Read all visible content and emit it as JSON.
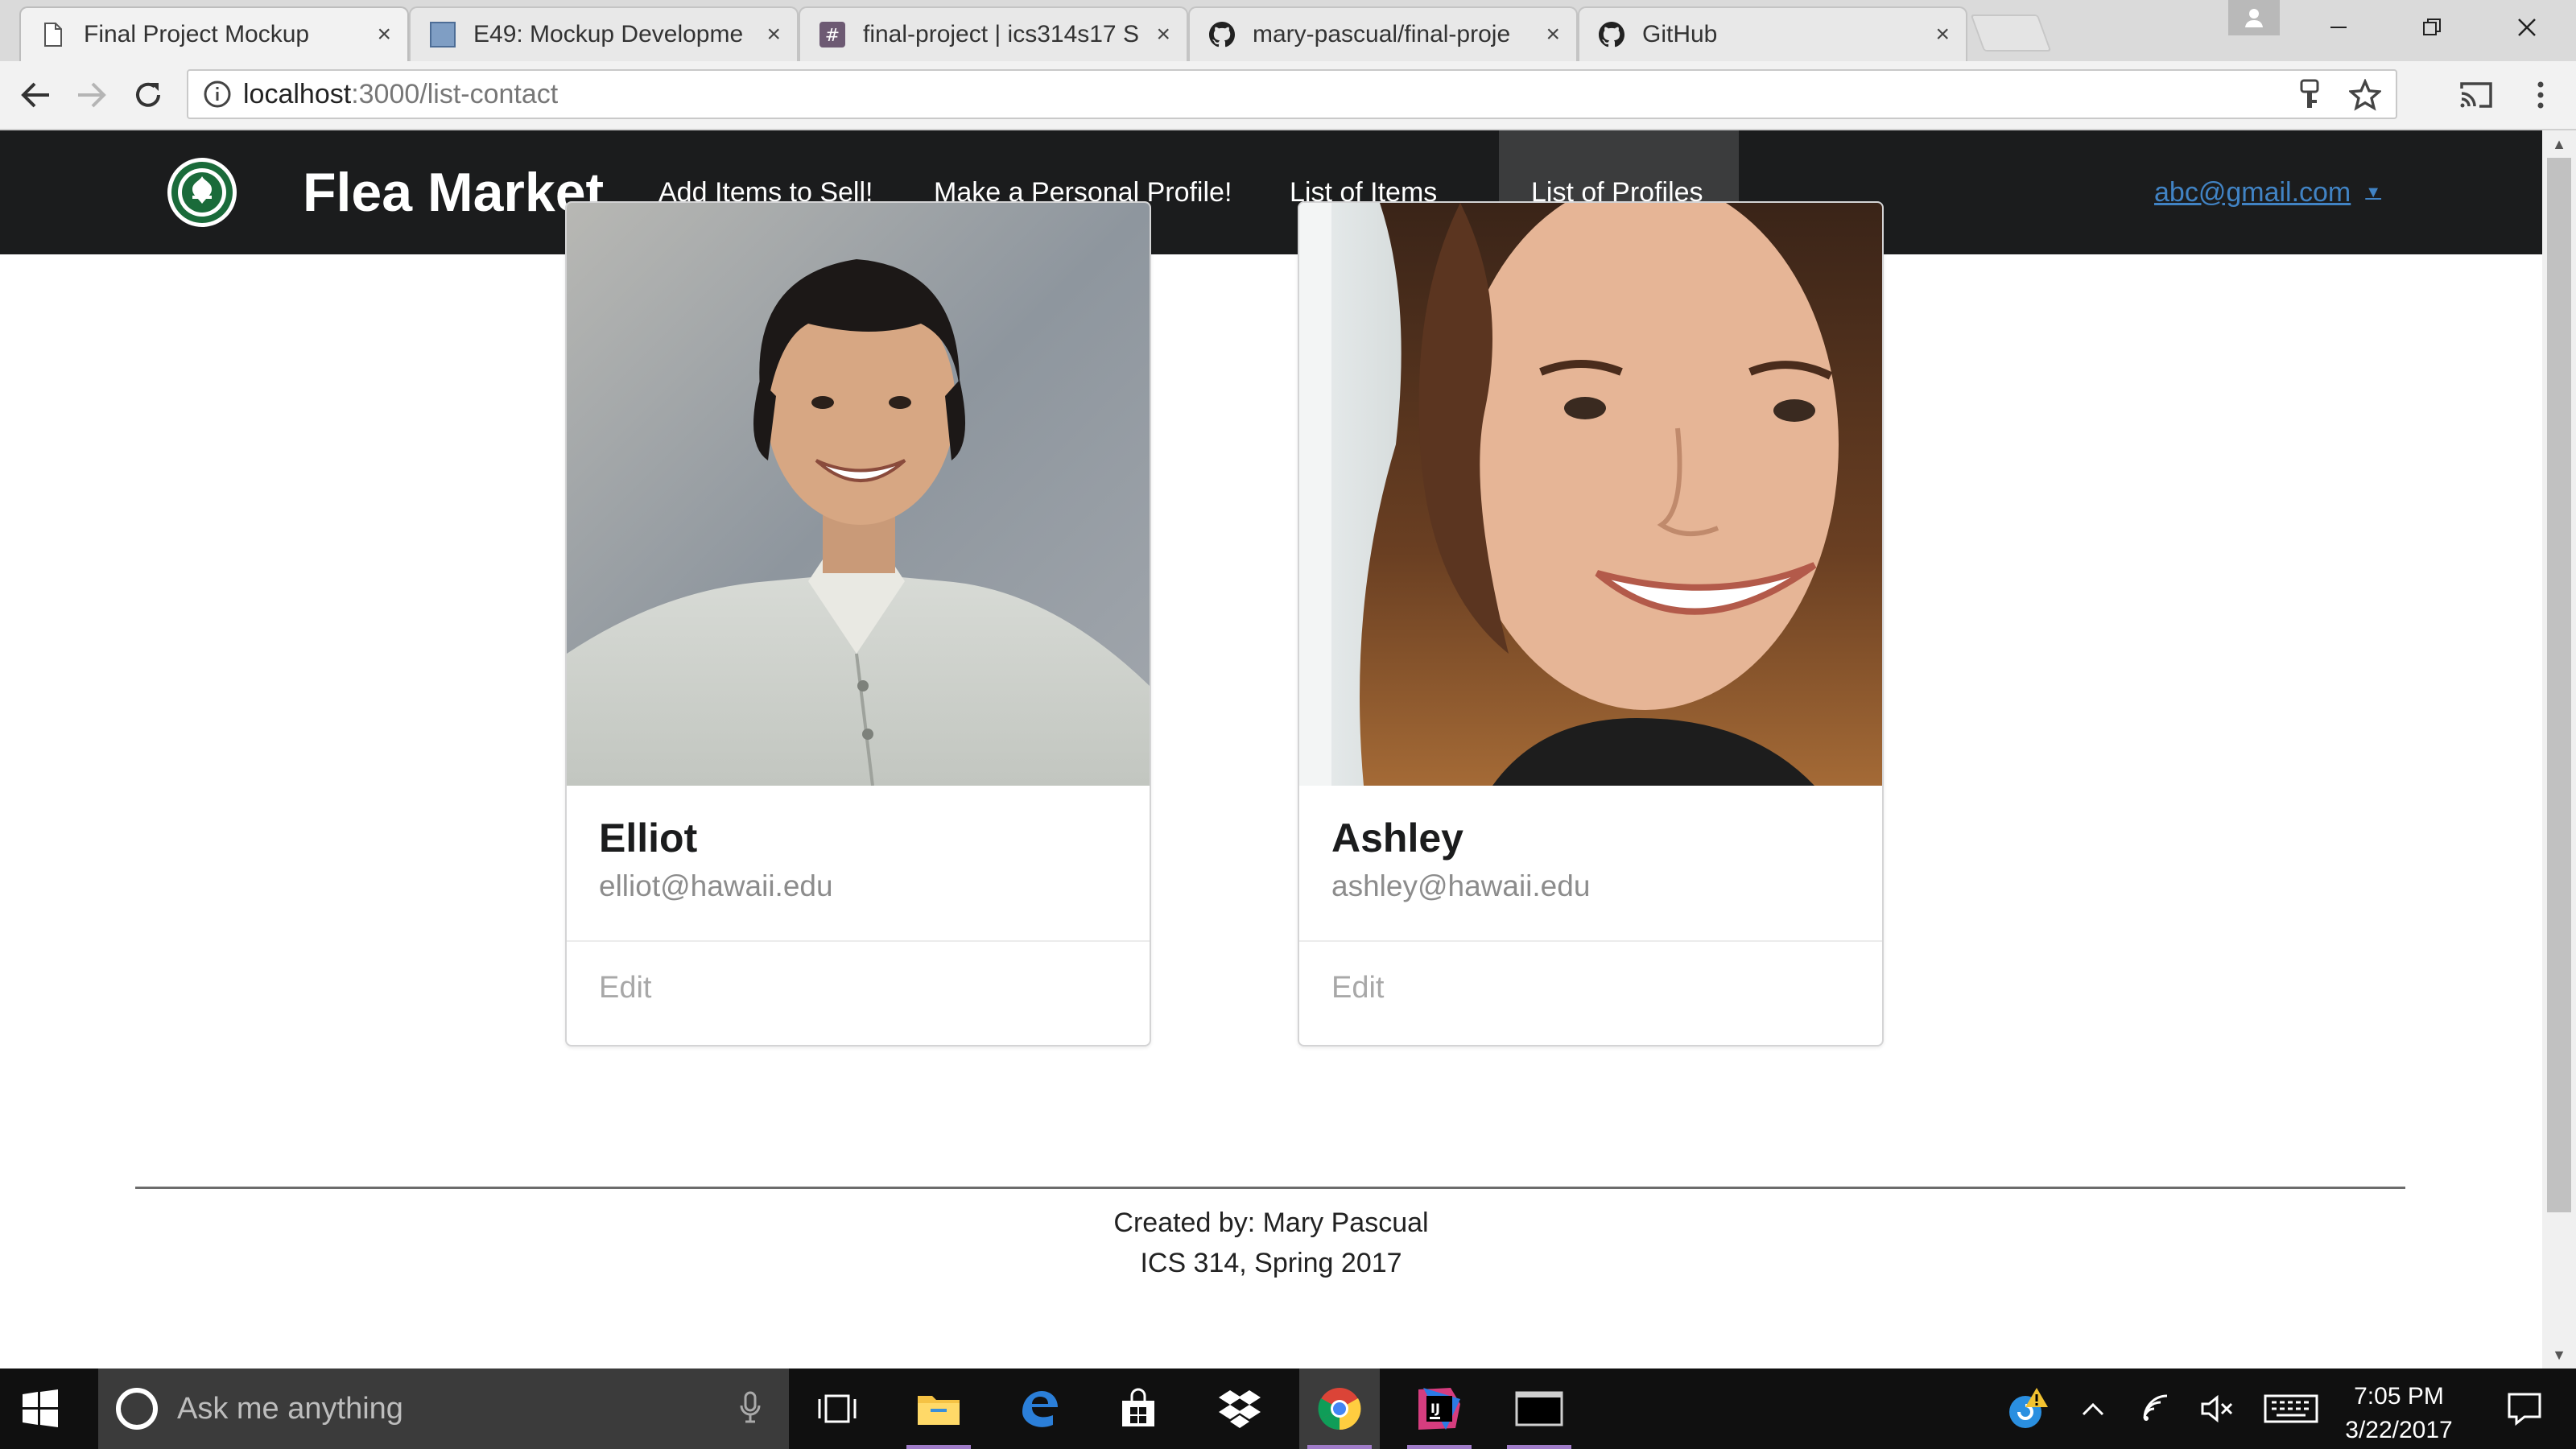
{
  "browser": {
    "tabs": [
      {
        "title": "Final Project Mockup",
        "icon": "page-icon",
        "active": true
      },
      {
        "title": "E49: Mockup Developme",
        "icon": "site-icon",
        "active": false
      },
      {
        "title": "final-project | ics314s17 S",
        "icon": "slack-icon",
        "active": false
      },
      {
        "title": "mary-pascual/final-proje",
        "icon": "github-icon",
        "active": false
      },
      {
        "title": "GitHub",
        "icon": "github-icon",
        "active": false
      }
    ],
    "close_glyph": "×",
    "url_host": "localhost",
    "url_path": ":3000/list-contact"
  },
  "site": {
    "brand": "Flea Market",
    "nav": [
      {
        "label": "Add Items to Sell!",
        "active": false
      },
      {
        "label": "Make a Personal Profile!",
        "active": false
      },
      {
        "label": "List of Items",
        "active": false
      },
      {
        "label": "List of Profiles",
        "active": true
      }
    ],
    "user_email": "abc@gmail.com",
    "user_caret": "▼"
  },
  "profiles": [
    {
      "name": "Elliot",
      "email": "elliot@hawaii.edu",
      "action": "Edit"
    },
    {
      "name": "Ashley",
      "email": "ashley@hawaii.edu",
      "action": "Edit"
    }
  ],
  "footer": {
    "line1": "Created by: Mary Pascual",
    "line2": "ICS 314, Spring 2017"
  },
  "taskbar": {
    "search_placeholder": "Ask me anything",
    "time": "7:05 PM",
    "date": "3/22/2017"
  },
  "colors": {
    "navbar": "#1b1c1d",
    "nav_active": "#3b3c3d",
    "link": "#4183c4",
    "taskbar": "#101010"
  }
}
